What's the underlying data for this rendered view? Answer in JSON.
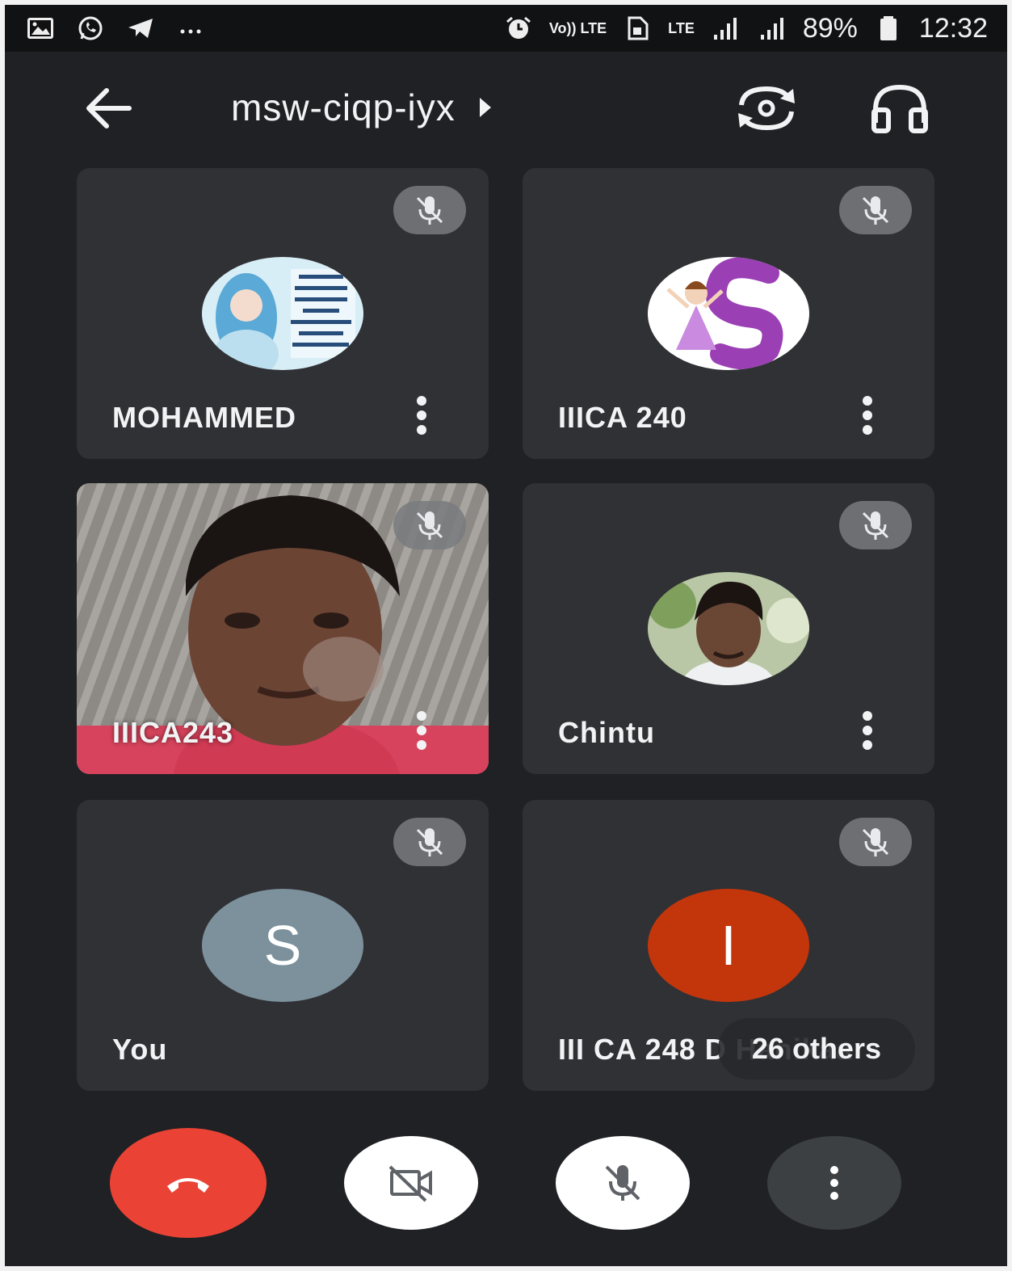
{
  "status_bar": {
    "left_icons": [
      "gallery-icon",
      "whatsapp-icon",
      "telegram-icon",
      "more-notifications-icon"
    ],
    "volte_text": "Vo)) LTE",
    "lte_text": "LTE",
    "battery": "89%",
    "time": "12:32"
  },
  "header": {
    "meeting_code": "msw-ciqp-iyx",
    "back_icon": "arrow-left-icon",
    "switch_camera_icon": "switch-camera-icon",
    "audio_icon": "headphones-icon"
  },
  "participants": [
    {
      "name": "MOHAMMED",
      "avatar": "image",
      "muted": true
    },
    {
      "name": "IIICA 240",
      "avatar": "image",
      "muted": true
    },
    {
      "name": "IIICA243",
      "avatar": "video",
      "muted": true
    },
    {
      "name": "Chintu",
      "avatar": "image",
      "muted": true
    },
    {
      "name": "You",
      "avatar_initial": "S",
      "avatar_color": "#7c919c",
      "muted": true
    },
    {
      "name": "III CA 248 D Hanikaa",
      "avatar_initial": "I",
      "avatar_color": "#c3360c",
      "muted": true
    }
  ],
  "others_chip": "26 others",
  "controls": {
    "end_call_color": "#ea4335",
    "icons": [
      "end-call-icon",
      "camera-off-icon",
      "mic-off-icon",
      "more-options-icon"
    ]
  }
}
